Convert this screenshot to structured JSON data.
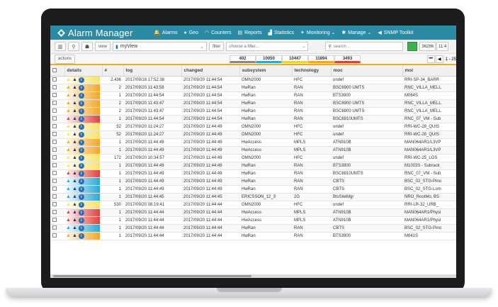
{
  "app": {
    "name": "Alarm Manager"
  },
  "nav": [
    {
      "label": "Alarms",
      "icon": "bell-icon",
      "glyph": "🔔"
    },
    {
      "label": "Geo",
      "icon": "globe-icon",
      "glyph": "●"
    },
    {
      "label": "Counters",
      "icon": "counters-icon",
      "glyph": "◠"
    },
    {
      "label": "Reports",
      "icon": "reports-icon",
      "glyph": "▤"
    },
    {
      "label": "Statistics",
      "icon": "statistics-icon",
      "glyph": "▟"
    },
    {
      "label": "Monitoring ⌄",
      "icon": "monitoring-icon",
      "glyph": "✦"
    },
    {
      "label": "Manage ⌄",
      "icon": "manage-icon",
      "glyph": "✱"
    },
    {
      "label": "SNMP Toolkit",
      "icon": "snmp-icon",
      "glyph": "◀"
    }
  ],
  "toolbar": {
    "view_label": "view",
    "view_value": "myView",
    "filter_label": "filter",
    "filter_placeholder": "choose a filter...",
    "search_placeholder": "search ..",
    "total_count": "36286",
    "extra": "11:4"
  },
  "actions": {
    "label": "actions",
    "counters": [
      {
        "value": "402",
        "color": "#888888"
      },
      {
        "value": "10050",
        "color": "#2aa8d8"
      },
      {
        "value": "10447",
        "color": "#e8d53a"
      },
      {
        "value": "11894",
        "color": "#f5a623"
      },
      {
        "value": "3493",
        "color": "#e0413e"
      }
    ],
    "pager_text": "1 - 25"
  },
  "table": {
    "columns": [
      "details",
      "#",
      "log",
      "changed",
      "subsystem",
      "technology",
      "moc",
      "moi"
    ],
    "rows": [
      {
        "sev": "yellow",
        "count": "2.436",
        "log": "2017/09/18 17:52:38",
        "changed": "2017/09/20 11:44:54",
        "subsystem": "OMN2000",
        "technology": "HFC",
        "moc": "undef",
        "moi": "RRI-SP-34_BARR"
      },
      {
        "sev": "orange",
        "count": "2",
        "log": "2017/09/20 11:43:58",
        "changed": "2017/09/20 11:44:54",
        "subsystem": "HwRan",
        "technology": "RAN",
        "moc": "BSC6900 UMTS",
        "moi": "RNC_VILLA_MELL"
      },
      {
        "sev": "orange",
        "count": "1",
        "log": "2017/09/20 11:44:54",
        "changed": "2017/09/20 11:44:54",
        "subsystem": "HwRan",
        "technology": "RAN",
        "moc": "BTS3900",
        "moi": "M064S"
      },
      {
        "sev": "orange",
        "count": "2",
        "log": "2017/09/20 11:43:47",
        "changed": "2017/09/20 11:44:54",
        "subsystem": "HwRan",
        "technology": "RAN",
        "moc": "BSC6900 UMTS",
        "moi": "RNC_VILLA_MELL"
      },
      {
        "sev": "orange",
        "count": "2",
        "log": "2017/09/20 11:43:47",
        "changed": "2017/09/20 11:44:54",
        "subsystem": "HwRan",
        "technology": "RAN",
        "moc": "BSC6900 UMTS",
        "moi": "RNC_VILLA_MELL"
      },
      {
        "sev": "red",
        "count": "1",
        "log": "2017/09/20 11:44:54",
        "changed": "2017/09/20 11:44:54",
        "subsystem": "HwRan",
        "technology": "RAN",
        "moc": "BSC6910UMTS",
        "moi": "RNC_07_VM - Sub"
      },
      {
        "sev": "yellow",
        "count": "52",
        "log": "2017/09/20 11:24:27",
        "changed": "2017/09/20 11:44:49",
        "subsystem": "OMN2000",
        "technology": "HFC",
        "moc": "undef",
        "moi": "RRI-WC-28_QUIS"
      },
      {
        "sev": "yellow",
        "count": "52",
        "log": "2017/09/20 11:24:27",
        "changed": "2017/09/20 11:44:49",
        "subsystem": "OMN2000",
        "technology": "HFC",
        "moc": "undef",
        "moi": "RRI-WC-28_QUIS"
      },
      {
        "sev": "orange",
        "count": "1",
        "log": "2017/09/20 11:44:49",
        "changed": "2017/09/20 11:44:49",
        "subsystem": "HwAccess",
        "technology": "MPLS",
        "moc": "ATN910B",
        "moi": "MAN064AR1/L3VP"
      },
      {
        "sev": "orange",
        "count": "1",
        "log": "2017/09/20 11:44:49",
        "changed": "2017/09/20 11:44:49",
        "subsystem": "HwAccess",
        "technology": "MPLS",
        "moc": "ATN910B",
        "moi": "MAN064AR1/L3VP"
      },
      {
        "sev": "yellow",
        "count": "172",
        "log": "2017/09/20 10:34:57",
        "changed": "2017/09/20 11:44:49",
        "subsystem": "OMN2000",
        "technology": "HFC",
        "moc": "undef",
        "moi": "RRI-WC-25_LOS"
      },
      {
        "sev": "yellow",
        "count": "1",
        "log": "2017/09/20 11:44:49",
        "changed": "2017/09/20 11:44:49",
        "subsystem": "HwRan",
        "technology": "RAN",
        "moc": "BTS3900",
        "moi": "M1003S - Subrack"
      },
      {
        "sev": "red",
        "count": "1",
        "log": "2017/09/20 11:44:49",
        "changed": "2017/09/20 11:44:49",
        "subsystem": "HwRan",
        "technology": "RAN",
        "moc": "BSC6910UMTS",
        "moi": "RNC_07_VM - Sub"
      },
      {
        "sev": "blue",
        "count": "1",
        "log": "2017/09/20 11:44:49",
        "changed": "2017/09/20 11:44:49",
        "subsystem": "HwRan",
        "technology": "RAN",
        "moc": "CBTS",
        "moi": "BSC_02_STG-Pino"
      },
      {
        "sev": "blue",
        "count": "1",
        "log": "2017/09/20 11:44:49",
        "changed": "2017/09/20 11:44:49",
        "subsystem": "HwRan",
        "technology": "RAN",
        "moc": "CBTS",
        "moi": "BSC_02_STG-Lom"
      },
      {
        "sev": "blue",
        "count": "1",
        "log": "2017/09/20 11:44:45",
        "changed": "2017/09/20 11:44:45",
        "subsystem": "ERICSSON_12_3",
        "technology": "2G",
        "moc": "BtsSiteMgr",
        "moi": "NRO_RootMo, BS"
      },
      {
        "sev": "yellow",
        "count": "530",
        "log": "2017/09/20 08:19:41",
        "changed": "2017/09/20 11:44:44",
        "subsystem": "OMN2000",
        "technology": "HFC",
        "moc": "undef",
        "moi": "RRI-LR-32_URB_"
      },
      {
        "sev": "red",
        "count": "1",
        "log": "2017/09/20 11:44:44",
        "changed": "2017/09/20 11:44:44",
        "subsystem": "HwAccess",
        "technology": "MPLS",
        "moc": "ATN910B",
        "moi": "MAN064AR1/Physi"
      },
      {
        "sev": "red",
        "count": "1",
        "log": "2017/09/20 11:44:44",
        "changed": "2017/09/20 11:44:44",
        "subsystem": "HwAccess",
        "technology": "MPLS",
        "moc": "ATN910B",
        "moi": "MAN064AR1/Physi"
      },
      {
        "sev": "blue",
        "count": "1",
        "log": "2017/09/20 11:44:44",
        "changed": "2017/09/20 11:44:44",
        "subsystem": "HwRan",
        "technology": "RAN",
        "moc": "CBTS",
        "moi": "BSC_02_STG-Pino"
      },
      {
        "sev": "orange",
        "count": "1",
        "log": "2017/09/20 11:44:44",
        "changed": "2017/09/20 11:44:44",
        "subsystem": "HwRan",
        "technology": "RAN",
        "moc": "BTS3900",
        "moi": "M041S"
      }
    ]
  },
  "severity_colors": {
    "yellow": "#f7e36a",
    "orange": "#f5a623",
    "red": "#e0413e",
    "blue": "#2aa8d8"
  }
}
